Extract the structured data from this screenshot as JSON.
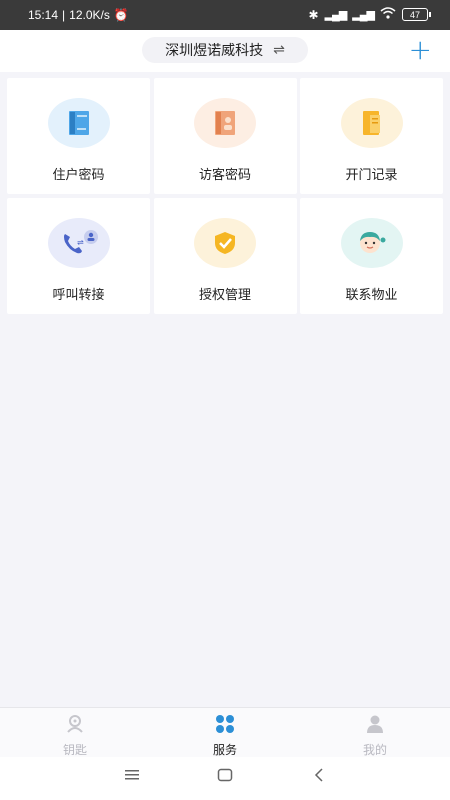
{
  "status": {
    "time": "15:14",
    "speed": "12.0K/s",
    "battery": "47"
  },
  "header": {
    "community": "深圳煜诺威科技",
    "swap_symbol": "⇌",
    "add_symbol": "+"
  },
  "services": [
    {
      "label": "住户密码",
      "icon": "resident-password-icon",
      "bg": "#e3f1fc"
    },
    {
      "label": "访客密码",
      "icon": "visitor-password-icon",
      "bg": "#fdeee3"
    },
    {
      "label": "开门记录",
      "icon": "door-record-icon",
      "bg": "#fdf2da"
    },
    {
      "label": "呼叫转接",
      "icon": "call-transfer-icon",
      "bg": "#e8ebfa"
    },
    {
      "label": "授权管理",
      "icon": "authorization-icon",
      "bg": "#fdf2da"
    },
    {
      "label": "联系物业",
      "icon": "contact-property-icon",
      "bg": "#e3f5f3"
    }
  ],
  "tabs": [
    {
      "label": "钥匙",
      "icon": "key-icon",
      "active": false
    },
    {
      "label": "服务",
      "icon": "service-grid-icon",
      "active": true
    },
    {
      "label": "我的",
      "icon": "profile-icon",
      "active": false
    }
  ],
  "colors": {
    "accent": "#2c8fd6",
    "inactive": "#b8b8c0"
  }
}
